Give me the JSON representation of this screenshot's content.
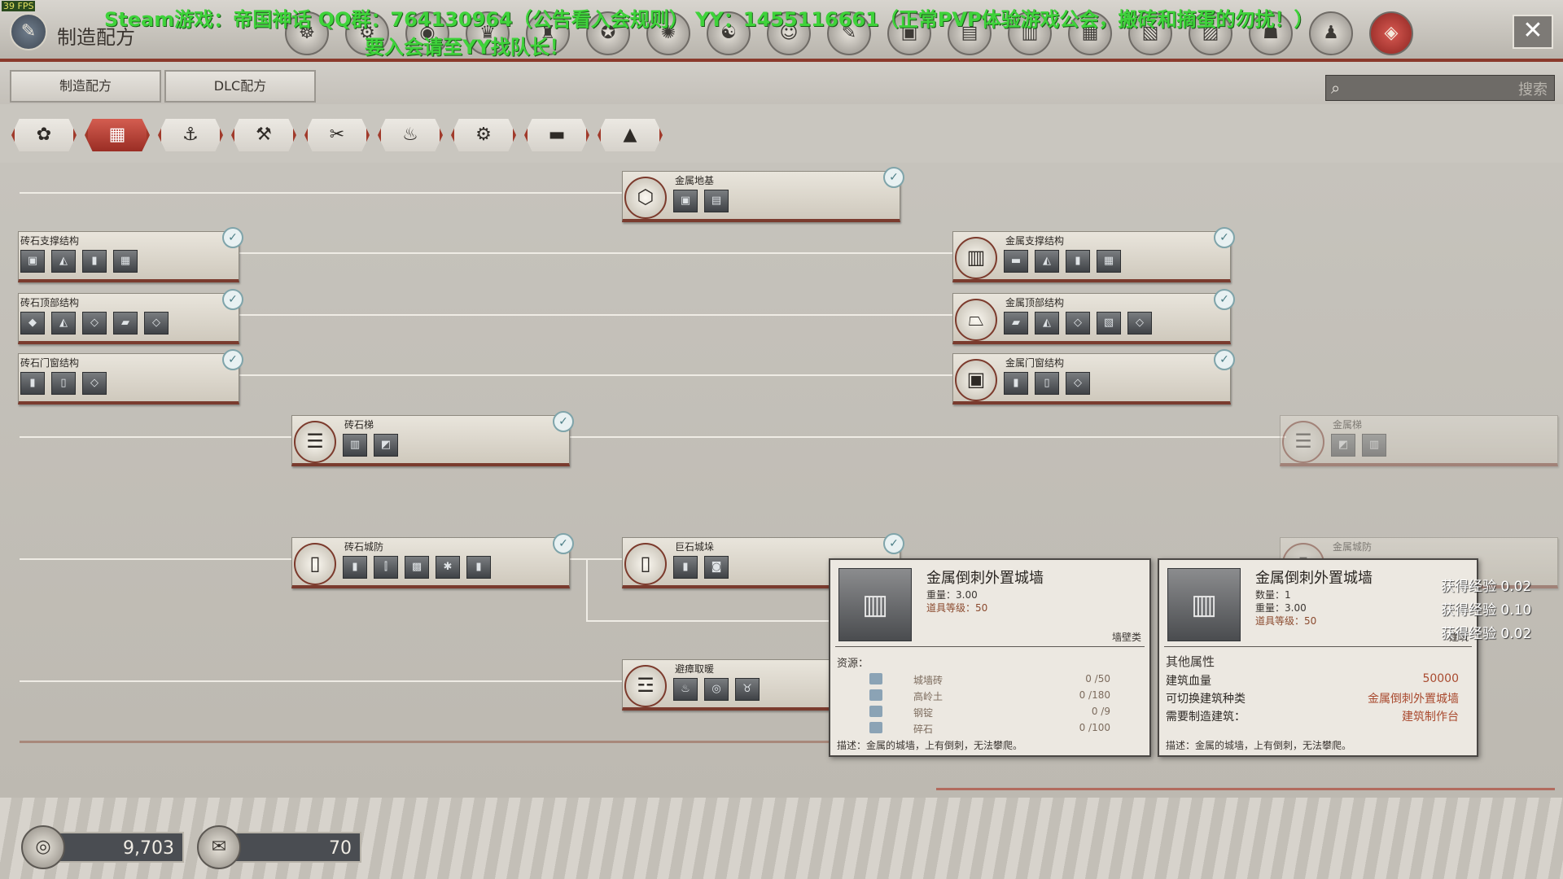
{
  "hud": {
    "fps": "39 FPS"
  },
  "header": {
    "title": "制造配方",
    "emblem_icon": "book-emblem-icon",
    "overlay_line1": "Steam游戏：帝国神话 QQ群：764130964（公告看入会规则） YY：1455116661（正常PVP体验游戏公会，搬砖和摘蛋的勿扰！）",
    "overlay_line2": "要入会请至YY找队长！",
    "overlay_color": "#3ed33a",
    "top_icons": [
      "☸",
      "⚙",
      "◉",
      "♛",
      "♜",
      "✪",
      "✺",
      "☯",
      "☺",
      "✎",
      "▣",
      "▤",
      "▥",
      "▦",
      "▧",
      "▨",
      "☗",
      "♟",
      "◈"
    ],
    "active_top_icon_color": "#c0392b"
  },
  "tabs": [
    {
      "label": "制造配方"
    },
    {
      "label": "DLC配方"
    }
  ],
  "search": {
    "placeholder": "",
    "button_label": "搜索"
  },
  "categories": [
    "✿",
    "▦",
    "⚓",
    "⚒",
    "✂",
    "♨",
    "⚙",
    "▬",
    "▲"
  ],
  "tree": {
    "nodes": [
      {
        "title": "金属地基",
        "badge": "⬡",
        "icons": [
          "▣",
          "▤"
        ],
        "checked": true
      },
      {
        "title": "砖石支撑结构",
        "badge": "",
        "icons": [
          "▣",
          "◭",
          "▮",
          "▦"
        ],
        "checked": true
      },
      {
        "title": "砖石顶部结构",
        "badge": "",
        "icons": [
          "◆",
          "◭",
          "◇",
          "▰",
          "◇"
        ],
        "checked": true
      },
      {
        "title": "砖石门窗结构",
        "badge": "",
        "icons": [
          "▮",
          "▯",
          "◇"
        ],
        "checked": true
      },
      {
        "title": "金属支撑结构",
        "badge": "▥",
        "icons": [
          "▬",
          "◭",
          "▮",
          "▦"
        ],
        "checked": true
      },
      {
        "title": "金属顶部结构",
        "badge": "⏢",
        "icons": [
          "▰",
          "◭",
          "◇",
          "▧",
          "◇"
        ],
        "checked": true
      },
      {
        "title": "金属门窗结构",
        "badge": "▣",
        "icons": [
          "▮",
          "▯",
          "◇"
        ],
        "checked": true
      },
      {
        "title": "砖石梯",
        "badge": "☰",
        "icons": [
          "▥",
          "◩"
        ],
        "checked": true
      },
      {
        "title": "金属梯",
        "badge": "☰",
        "icons": [
          "◩",
          "▥"
        ],
        "checked": false
      },
      {
        "title": "砖石城防",
        "badge": "▯",
        "icons": [
          "▮",
          "⫿",
          "▩",
          "✱",
          "▮"
        ],
        "checked": true
      },
      {
        "title": "巨石城垛",
        "badge": "▯",
        "icons": [
          "▮",
          "◙"
        ],
        "checked": true
      },
      {
        "title": "金属城防",
        "badge": "▯",
        "icons": [],
        "checked": false
      },
      {
        "title": "避瘴取暖",
        "badge": "☲",
        "icons": [
          "♨",
          "◎",
          "♉"
        ],
        "checked": false
      }
    ]
  },
  "tooltip_left": {
    "name": "金属倒刺外置城墙",
    "weight": "重量：3.00",
    "item_level": "道具等级：50",
    "category": "墙壁类",
    "resources_label": "资源：",
    "resources": [
      {
        "name": "城墙砖",
        "count": "0 /50"
      },
      {
        "name": "高岭土",
        "count": "0 /180"
      },
      {
        "name": "钢锭",
        "count": "0 /9"
      },
      {
        "name": "碎石",
        "count": "0 /100"
      }
    ],
    "description": "描述：金属的城墙，上有倒刺，无法攀爬。"
  },
  "tooltip_right": {
    "name": "金属倒刺外置城墙",
    "quantity": "数量：1",
    "weight": "重量：3.00",
    "item_level": "道具等级：50",
    "category": "建筑",
    "other_props_label": "其他属性",
    "props": [
      {
        "label": "建筑血量",
        "value": "50000"
      },
      {
        "label": "可切换建筑种类",
        "value": "金属倒刺外置城墙"
      },
      {
        "label": "需要制造建筑：",
        "value": "建筑制作台"
      }
    ],
    "description": "描述：金属的城墙，上有倒刺，无法攀爬。"
  },
  "xp_popups": [
    "获得经验 0.02",
    "获得经验 0.10",
    "获得经验 0.02"
  ],
  "footer": {
    "currency1_value": "9,703",
    "currency2_value": "70"
  }
}
